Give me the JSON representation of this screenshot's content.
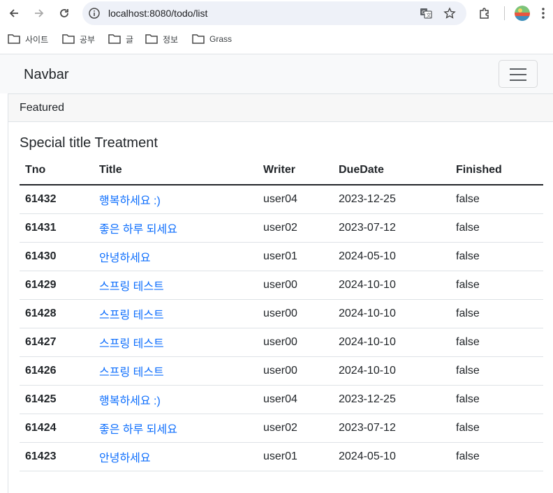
{
  "browser": {
    "url": "localhost:8080/todo/list",
    "bookmarks": [
      "사이트",
      "공부",
      "글",
      "정보",
      "Grass"
    ]
  },
  "navbar": {
    "brand": "Navbar"
  },
  "card": {
    "header": "Featured",
    "title": "Special title Treatment"
  },
  "table": {
    "columns": [
      "Tno",
      "Title",
      "Writer",
      "DueDate",
      "Finished"
    ],
    "rows": [
      {
        "tno": "61432",
        "title": "행복하세요 :)",
        "writer": "user04",
        "dueDate": "2023-12-25",
        "finished": "false"
      },
      {
        "tno": "61431",
        "title": "좋은 하루 되세요",
        "writer": "user02",
        "dueDate": "2023-07-12",
        "finished": "false"
      },
      {
        "tno": "61430",
        "title": "안녕하세요",
        "writer": "user01",
        "dueDate": "2024-05-10",
        "finished": "false"
      },
      {
        "tno": "61429",
        "title": "스프링 테스트",
        "writer": "user00",
        "dueDate": "2024-10-10",
        "finished": "false"
      },
      {
        "tno": "61428",
        "title": "스프링 테스트",
        "writer": "user00",
        "dueDate": "2024-10-10",
        "finished": "false"
      },
      {
        "tno": "61427",
        "title": "스프링 테스트",
        "writer": "user00",
        "dueDate": "2024-10-10",
        "finished": "false"
      },
      {
        "tno": "61426",
        "title": "스프링 테스트",
        "writer": "user00",
        "dueDate": "2024-10-10",
        "finished": "false"
      },
      {
        "tno": "61425",
        "title": "행복하세요 :)",
        "writer": "user04",
        "dueDate": "2023-12-25",
        "finished": "false"
      },
      {
        "tno": "61424",
        "title": "좋은 하루 되세요",
        "writer": "user02",
        "dueDate": "2023-07-12",
        "finished": "false"
      },
      {
        "tno": "61423",
        "title": "안녕하세요",
        "writer": "user01",
        "dueDate": "2024-05-10",
        "finished": "false"
      }
    ]
  },
  "colors": {
    "link": "#0d6efd",
    "navbar_bg": "#f8f9fa",
    "omnibox_bg": "#eef1f8"
  },
  "icons": [
    "back-icon",
    "forward-icon",
    "reload-icon",
    "info-icon",
    "translate-icon",
    "star-icon",
    "extensions-icon",
    "folder-icon",
    "hamburger-icon"
  ]
}
